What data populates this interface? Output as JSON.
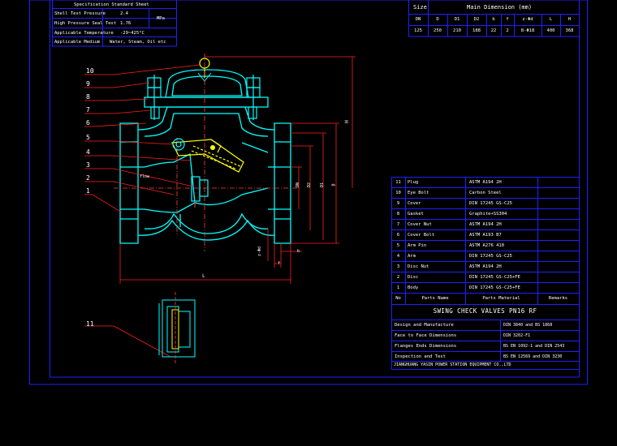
{
  "spec_table": {
    "title": "Specification Standard Sheet",
    "rows": [
      {
        "label": "Shell Test Pressure",
        "value": "2.4"
      },
      {
        "label": "High Pressure Seal Test",
        "value": "1.76"
      },
      {
        "label": "Applicable Temperature",
        "value": "-29~425°C"
      },
      {
        "label": "Applicable Medium",
        "value": "Water, Steam, Oil etc"
      }
    ],
    "unit": "MPa"
  },
  "dimension_table": {
    "size_label": "Size",
    "title": "Main Dimension (mm)",
    "headers": [
      "DN",
      "D",
      "D1",
      "D2",
      "b",
      "f",
      "z-Φd",
      "L",
      "H"
    ],
    "values": [
      "125",
      "250",
      "210",
      "188",
      "22",
      "2",
      "8-Φ18",
      "400",
      "368"
    ]
  },
  "callouts": [
    "10",
    "9",
    "8",
    "7",
    "6",
    "5",
    "4",
    "3",
    "2",
    "1",
    "11"
  ],
  "drawing_labels": {
    "flow": "flow",
    "length": "L",
    "height": "H",
    "dn": "DN",
    "d2": "D2",
    "d1": "D1",
    "d": "D",
    "f": "f",
    "b": "b",
    "zd": "z-Φd"
  },
  "parts_table": {
    "rows": [
      {
        "no": "11",
        "name": "Plug",
        "material": "ASTM A194 2H"
      },
      {
        "no": "10",
        "name": "Eye Bolt",
        "material": "Carbon Steel"
      },
      {
        "no": "9",
        "name": "Cover",
        "material": "DIN 17245 GS-C25"
      },
      {
        "no": "8",
        "name": "Gasket",
        "material": "Graphite+SS304"
      },
      {
        "no": "7",
        "name": "Cover Nut",
        "material": "ASTM A194 2H"
      },
      {
        "no": "6",
        "name": "Cover Bolt",
        "material": "ASTM A193 B7"
      },
      {
        "no": "5",
        "name": "Arm Pin",
        "material": "ASTM A276 410"
      },
      {
        "no": "4",
        "name": "Arm",
        "material": "DIN 17245 GS-C25"
      },
      {
        "no": "3",
        "name": "Disc Nut",
        "material": "ASTM A194 2H"
      },
      {
        "no": "2",
        "name": "Disc",
        "material": "DIN 17245 GS-C25+FE"
      },
      {
        "no": "1",
        "name": "Body",
        "material": "DIN 17245 GS-C25+FE"
      }
    ],
    "header_no": "No",
    "header_name": "Parts Name",
    "header_material": "Parts Material",
    "header_remarks": "Remarks"
  },
  "title_block": {
    "title": "SWING CHECK VALVES PN16 RF",
    "rows": [
      {
        "label": "Design and Manufacture",
        "value": "DIN 3840 and BS 1868"
      },
      {
        "label": "Face to Face Dimensions",
        "value": "DIN 3202-F1"
      },
      {
        "label": "Flanges Ends Dimensions",
        "value": "BS EN 1092-1 and DIN 2543"
      },
      {
        "label": "Inspection and Test",
        "value": "BS EN 12569 and DIN 3230"
      }
    ],
    "company": "JIANGHUANG YASIN POWER STATION EQUIPMENT CO.,LTD"
  },
  "colors": {
    "frame": "#2020ff",
    "outline": "#00ffff",
    "callout": "#ff2020",
    "disc": "#ffff00",
    "text": "#ffffff",
    "center": "#ff4040"
  }
}
